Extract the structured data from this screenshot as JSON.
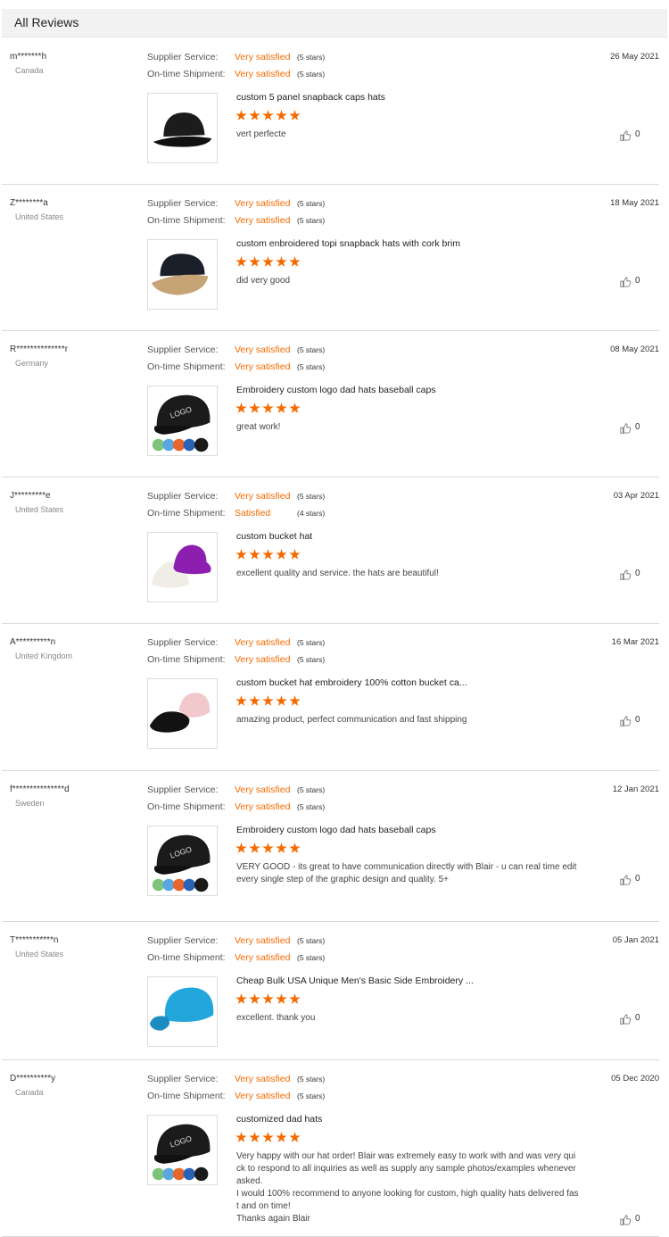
{
  "header": {
    "title": "All Reviews"
  },
  "labels": {
    "supplier_service": "Supplier Service:",
    "ontime_shipment": "On-time Shipment:"
  },
  "colors": {
    "accent": "#f56a00",
    "divider": "#d9d9d9",
    "header_bg": "#f2f2f2"
  },
  "reviews": [
    {
      "user": "m*******h",
      "country": "Canada",
      "date": "26 May 2021",
      "supplier_rating": "Very satisfied",
      "supplier_stars": "(5 stars)",
      "shipment_rating": "Very satisfied",
      "shipment_stars": "(5 stars)",
      "product_title": "custom 5 panel snapback caps hats",
      "stars": 5,
      "comment": "vert perfecte",
      "likes": "0",
      "image_icon": "black-snapback-cap-image"
    },
    {
      "user": "Z********a",
      "country": "United States",
      "date": "18 May 2021",
      "supplier_rating": "Very satisfied",
      "supplier_stars": "(5 stars)",
      "shipment_rating": "Very satisfied",
      "shipment_stars": "(5 stars)",
      "product_title": "custom enbroidered topi snapback hats with cork brim",
      "stars": 5,
      "comment": "did very good",
      "likes": "0",
      "image_icon": "cork-brim-snapback-image"
    },
    {
      "user": "R**************r",
      "country": "Germany",
      "date": "08 May 2021",
      "supplier_rating": "Very satisfied",
      "supplier_stars": "(5 stars)",
      "shipment_rating": "Very satisfied",
      "shipment_stars": "(5 stars)",
      "product_title": "Embroidery custom logo dad hats baseball caps",
      "stars": 5,
      "comment": "great work!",
      "likes": "0",
      "image_icon": "logo-dad-hat-image",
      "image_text": "LOGO"
    },
    {
      "user": "J*********e",
      "country": "United States",
      "date": "03 Apr 2021",
      "supplier_rating": "Very satisfied",
      "supplier_stars": "(5 stars)",
      "shipment_rating": "Satisfied",
      "shipment_stars": "(4 stars)",
      "product_title": "custom bucket hat",
      "stars": 5,
      "comment": "excellent quality and service. the hats are beautiful!",
      "likes": "0",
      "image_icon": "bucket-hats-image"
    },
    {
      "user": "A**********n",
      "country": "United Kingdom",
      "date": "16 Mar 2021",
      "supplier_rating": "Very satisfied",
      "supplier_stars": "(5 stars)",
      "shipment_rating": "Very satisfied",
      "shipment_stars": "(5 stars)",
      "product_title": "custom bucket hat embroidery 100% cotton bucket ca...",
      "stars": 5,
      "comment": "amazing product, perfect communication and fast shipping",
      "likes": "0",
      "image_icon": "cotton-bucket-hats-image"
    },
    {
      "user": "f***************d",
      "country": "Sweden",
      "date": "12 Jan 2021",
      "supplier_rating": "Very satisfied",
      "supplier_stars": "(5 stars)",
      "shipment_rating": "Very satisfied",
      "shipment_stars": "(5 stars)",
      "product_title": "Embroidery custom logo dad hats baseball caps",
      "stars": 5,
      "comment": "VERY GOOD - its great to have communication directly with Blair - u can real time edit every single step of the graphic design and quality. 5+",
      "likes": "0",
      "image_icon": "logo-dad-hat-image",
      "image_text": "LOGO"
    },
    {
      "user": "T***********n",
      "country": "United States",
      "date": "05 Jan 2021",
      "supplier_rating": "Very satisfied",
      "supplier_stars": "(5 stars)",
      "shipment_rating": "Very satisfied",
      "shipment_stars": "(5 stars)",
      "product_title": "Cheap Bulk USA Unique Men's Basic Side Embroidery ...",
      "stars": 5,
      "comment": "excellent. thank you",
      "likes": "0",
      "image_icon": "blue-baseball-cap-image"
    },
    {
      "user": "D**********y",
      "country": "Canada",
      "date": "05 Dec 2020",
      "supplier_rating": "Very satisfied",
      "supplier_stars": "(5 stars)",
      "shipment_rating": "Very satisfied",
      "shipment_stars": "(5 stars)",
      "product_title": "customized dad hats",
      "stars": 5,
      "comment": "Very happy with our hat order! Blair was extremely easy to work with and was very quick to respond to all inquiries as well as supply any sample photos/examples whenever asked.\nI would 100% recommend to anyone looking for custom, high quality hats delivered fast and on time!\nThanks again Blair",
      "likes": "0",
      "image_icon": "logo-dad-hat-image",
      "image_text": "LOGO"
    }
  ]
}
